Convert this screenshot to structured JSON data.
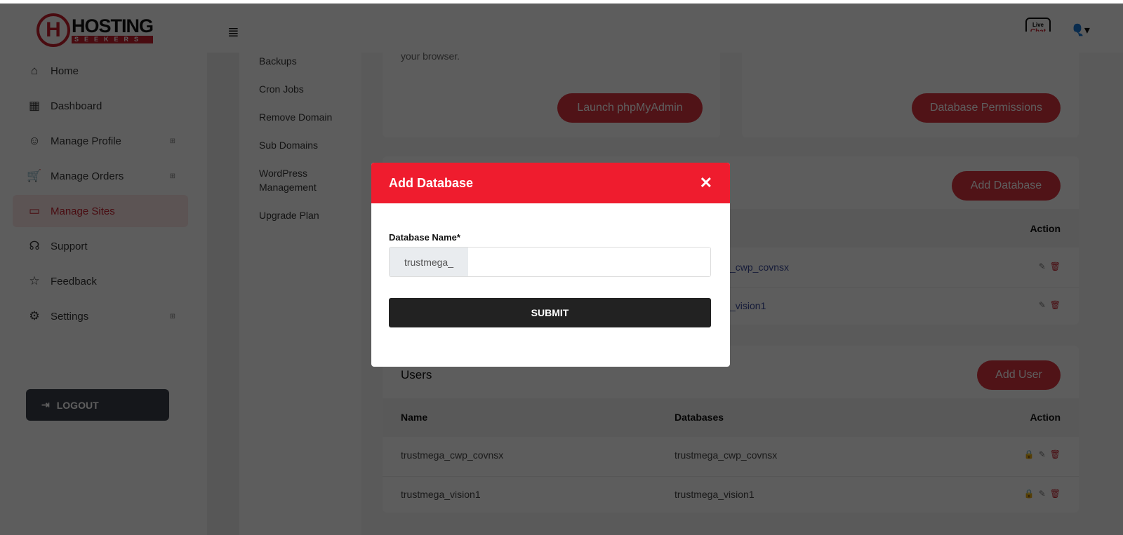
{
  "header": {
    "logo_main": "HOSTING",
    "logo_sub": "SEEKERS",
    "live_chat_top": "Live",
    "live_chat_bottom": "Chat"
  },
  "sidebar": {
    "items": [
      {
        "label": "Home",
        "icon": "⌂"
      },
      {
        "label": "Dashboard",
        "icon": "▦"
      },
      {
        "label": "Manage Profile",
        "icon": "☺"
      },
      {
        "label": "Manage Orders",
        "icon": "🛒"
      },
      {
        "label": "Manage Sites",
        "icon": "▭"
      },
      {
        "label": "Support",
        "icon": "☊"
      },
      {
        "label": "Feedback",
        "icon": "☆"
      },
      {
        "label": "Settings",
        "icon": "⚙"
      }
    ],
    "logout": "LOGOUT"
  },
  "submenu": [
    "Backups",
    "Cron Jobs",
    "Remove Domain",
    "Sub Domains",
    "WordPress Management",
    "Upgrade Plan"
  ],
  "cards": {
    "phpmyadmin_text": "your browser.",
    "launch_phpmyadmin": "Launch phpMyAdmin",
    "database_permissions": "Database Permissions",
    "add_database": "Add Database"
  },
  "databases": {
    "action_header": "Action",
    "rows": [
      "_cwp_covnsx",
      "_vision1"
    ]
  },
  "users": {
    "title": "Users",
    "add_user": "Add User",
    "headers": [
      "Name",
      "Databases",
      "Action"
    ],
    "rows": [
      [
        "trustmega_cwp_covnsx",
        "trustmega_cwp_covnsx"
      ],
      [
        "trustmega_vision1",
        "trustmega_vision1"
      ]
    ]
  },
  "modal": {
    "title": "Add Database",
    "label": "Database Name*",
    "prefix": "trustmega_",
    "value": "",
    "submit": "SUBMIT"
  },
  "colors": {
    "accent": "#ef1c2e",
    "brand_red": "#c41e2b",
    "submit": "#222222"
  }
}
